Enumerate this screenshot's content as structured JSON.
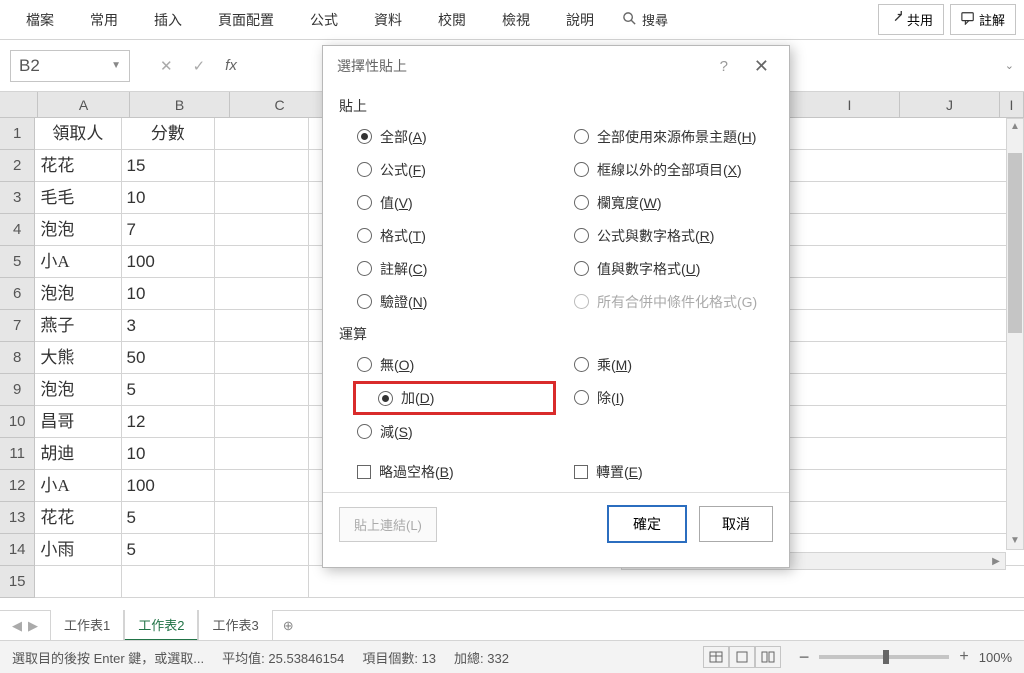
{
  "ribbon": {
    "tabs": [
      "檔案",
      "常用",
      "插入",
      "頁面配置",
      "公式",
      "資料",
      "校閱",
      "檢視",
      "說明"
    ],
    "search_label": "搜尋",
    "share_label": "共用",
    "comment_label": "註解"
  },
  "namebox": {
    "value": "B2"
  },
  "columns": [
    "A",
    "B",
    "C",
    "I",
    "J",
    "I"
  ],
  "rows": [
    {
      "n": "1",
      "a": "領取人",
      "b": "分數",
      "hdr": true
    },
    {
      "n": "2",
      "a": "花花",
      "b": "15"
    },
    {
      "n": "3",
      "a": "毛毛",
      "b": "10"
    },
    {
      "n": "4",
      "a": "泡泡",
      "b": "7"
    },
    {
      "n": "5",
      "a": "小A",
      "b": "100"
    },
    {
      "n": "6",
      "a": "泡泡",
      "b": "10"
    },
    {
      "n": "7",
      "a": "燕子",
      "b": "3"
    },
    {
      "n": "8",
      "a": "大熊",
      "b": "50"
    },
    {
      "n": "9",
      "a": "泡泡",
      "b": "5"
    },
    {
      "n": "10",
      "a": "昌哥",
      "b": "12"
    },
    {
      "n": "11",
      "a": "胡迪",
      "b": "10"
    },
    {
      "n": "12",
      "a": "小A",
      "b": "100"
    },
    {
      "n": "13",
      "a": "花花",
      "b": "5"
    },
    {
      "n": "14",
      "a": "小雨",
      "b": "5"
    },
    {
      "n": "15",
      "a": "",
      "b": ""
    }
  ],
  "sheets": {
    "items": [
      "工作表1",
      "工作表2",
      "工作表3"
    ],
    "active": 1
  },
  "status": {
    "mode": "選取目的後按 Enter 鍵，或選取...",
    "avg_label": "平均值:",
    "avg": "25.53846154",
    "count_label": "項目個數:",
    "count": "13",
    "sum_label": "加總:",
    "sum": "332",
    "zoom": "100%"
  },
  "dialog": {
    "title": "選擇性貼上",
    "section_paste": "貼上",
    "paste_opts_left": [
      {
        "label": "全部",
        "accel": "A",
        "checked": true
      },
      {
        "label": "公式",
        "accel": "F"
      },
      {
        "label": "值",
        "accel": "V"
      },
      {
        "label": "格式",
        "accel": "T"
      },
      {
        "label": "註解",
        "accel": "C"
      },
      {
        "label": "驗證",
        "accel": "N"
      }
    ],
    "paste_opts_right": [
      {
        "label": "全部使用來源佈景主題",
        "accel": "H"
      },
      {
        "label": "框線以外的全部項目",
        "accel": "X"
      },
      {
        "label": "欄寬度",
        "accel": "W"
      },
      {
        "label": "公式與數字格式",
        "accel": "R"
      },
      {
        "label": "值與數字格式",
        "accel": "U"
      },
      {
        "label": "所有合併中條件化格式(G)",
        "disabled": true
      }
    ],
    "section_op": "運算",
    "op_opts_left": [
      {
        "label": "無",
        "accel": "O"
      },
      {
        "label": "加",
        "accel": "D",
        "checked": true,
        "highlight": true
      },
      {
        "label": "減",
        "accel": "S"
      }
    ],
    "op_opts_right": [
      {
        "label": "乘",
        "accel": "M"
      },
      {
        "label": "除",
        "accel": "I"
      }
    ],
    "chk_skip": {
      "label": "略過空格",
      "accel": "B"
    },
    "chk_transpose": {
      "label": "轉置",
      "accel": "E"
    },
    "paste_link": "貼上連結(L)",
    "ok": "確定",
    "cancel": "取消"
  }
}
